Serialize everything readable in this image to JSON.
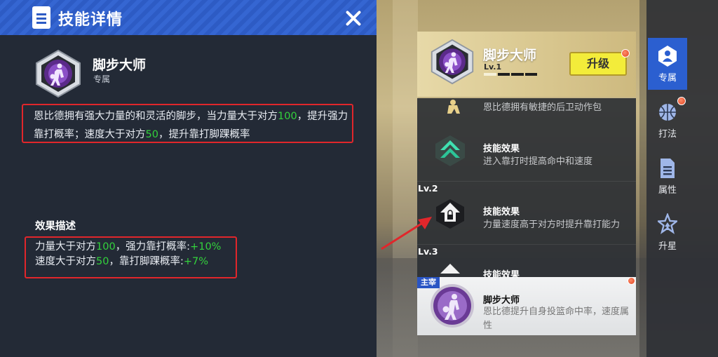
{
  "detail_panel": {
    "title": "技能详情",
    "skill_name": "脚步大师",
    "skill_tag": "专属",
    "description": {
      "part1": "恩比德拥有强大力量的和灵活的脚步，当力量大于对方",
      "value1": "100",
      "part2": "，提升强力靠打概率；速度大于对方",
      "value2": "50",
      "part3": "，提升靠打脚踝概率"
    },
    "effect_title": "效果描述",
    "effects": [
      {
        "prefix": "力量大于对方",
        "threshold": "100",
        "middle": "，强力靠打概率:",
        "bonus": "+10%"
      },
      {
        "prefix": "速度大于对方",
        "threshold": "50",
        "middle": "，靠打脚踝概率:",
        "bonus": "+7%"
      }
    ]
  },
  "skill_card": {
    "name": "脚步大师",
    "level": "Lv.1",
    "level_progress": 0.25,
    "upgrade_label": "升级"
  },
  "skill_list": {
    "row1_desc": "恩比德拥有敏捷的后卫动作包",
    "row2_title": "技能效果",
    "row2_desc": "进入靠打时提高命中和速度",
    "lv2_label": "Lv.2",
    "row3_title": "技能效果",
    "row3_desc": "力量速度高于对方时提升靠打能力",
    "lv3_label": "Lv.3",
    "row4_title": "技能效果"
  },
  "main_skill": {
    "tag": "主宰",
    "name": "脚步大师",
    "description": "恩比德提升自身投篮命中率，速度属性"
  },
  "side_tabs": [
    {
      "label": "专属",
      "icon": "exclusive-icon",
      "active": true
    },
    {
      "label": "打法",
      "icon": "basketball-icon",
      "active": false
    },
    {
      "label": "属性",
      "icon": "document-icon",
      "active": false
    },
    {
      "label": "升星",
      "icon": "star-icon",
      "active": false
    }
  ],
  "colors": {
    "accent_blue": "#2b5fd0",
    "highlight_green": "#33d23c",
    "annotation_red": "#e1262b",
    "upgrade_yellow": "#f3ec3a"
  }
}
